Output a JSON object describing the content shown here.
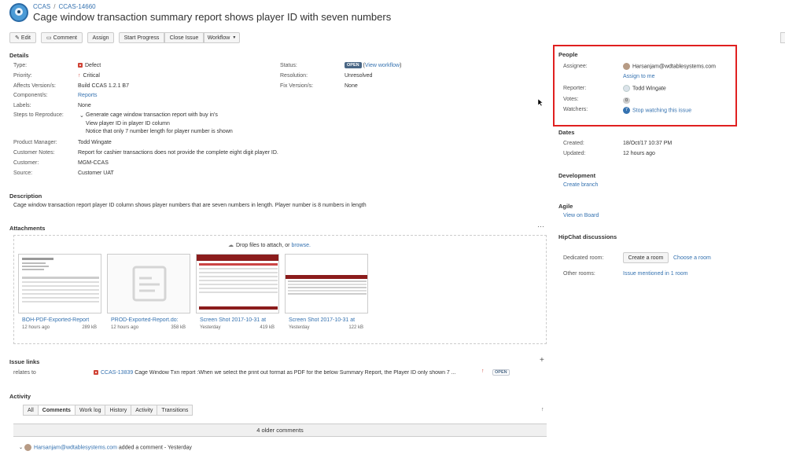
{
  "header": {
    "project": "CCAS",
    "issue_key": "CCAS-14660",
    "title": "Cage window transaction summary report shows player ID with seven numbers"
  },
  "toolbar": {
    "edit": "Edit",
    "comment": "Comment",
    "assign": "Assign",
    "start_progress": "Start Progress",
    "close_issue": "Close Issue",
    "workflow": "Workflow"
  },
  "details": {
    "title": "Details",
    "type_label": "Type:",
    "type": "Defect",
    "priority_label": "Priority:",
    "priority": "Critical",
    "affects_label": "Affects Version/s:",
    "affects": "Build CCAS 1.2.1 B7",
    "components_label": "Component/s:",
    "components": "Reports",
    "labels_label": "Labels:",
    "labels": "None",
    "steps_label": "Steps to Reproduce:",
    "steps": [
      "Generate cage window transaction report with buy in's",
      "View player ID in player ID column",
      "Notice that only 7 number length for player number is shown"
    ],
    "pm_label": "Product Manager:",
    "pm": "Todd Wingate",
    "notes_label": "Customer Notes:",
    "notes": "Report for cashier transactions does not provide the complete eight digit player ID.",
    "customer_label": "Customer:",
    "customer": "MGM-CCAS",
    "source_label": "Source:",
    "source": "Customer UAT",
    "status_label": "Status:",
    "status": "OPEN",
    "view_workflow": "View workflow",
    "resolution_label": "Resolution:",
    "resolution": "Unresolved",
    "fix_label": "Fix Version/s:",
    "fix": "None"
  },
  "description": {
    "title": "Description",
    "text": "Cage window transaction report player ID column shows player numbers that are seven numbers in length. Player number is 8 numbers in length"
  },
  "attachments": {
    "title": "Attachments",
    "drop_text": "Drop files to attach, or",
    "browse": "browse.",
    "items": [
      {
        "name": "BOH-PDF-Exported-Report",
        "time": "12 hours ago",
        "size": "289 kB"
      },
      {
        "name": "PROD-Exported-Report.do:",
        "time": "12 hours ago",
        "size": "358 kB"
      },
      {
        "name": "Screen Shot 2017-10-31 at",
        "time": "Yesterday",
        "size": "419 kB"
      },
      {
        "name": "Screen Shot 2017-10-31 at",
        "time": "Yesterday",
        "size": "122 kB"
      }
    ]
  },
  "issue_links": {
    "title": "Issue links",
    "relation": "relates to",
    "key": "CCAS-13839",
    "summary": "Cage Window Txn report :When we select the print out format as PDF for the below Summary Report, the Player ID only shown 7 ...",
    "status": "OPEN"
  },
  "activity": {
    "title": "Activity",
    "tabs": [
      "All",
      "Comments",
      "Work log",
      "History",
      "Activity",
      "Transitions"
    ],
    "active_tab": "Comments",
    "older": "4 older comments",
    "comment_author": "Harsanjam@wdtablesystems.com",
    "comment_meta": "added a comment - Yesterday"
  },
  "people": {
    "title": "People",
    "assignee_label": "Assignee:",
    "assignee": "Harsanjam@wdtablesystems.com",
    "assign_me": "Assign to me",
    "reporter_label": "Reporter:",
    "reporter": "Todd Wingate",
    "votes_label": "Votes:",
    "votes": "0",
    "watchers_label": "Watchers:",
    "watchers": "7",
    "stop_watching": "Stop watching this issue"
  },
  "dates": {
    "title": "Dates",
    "created_label": "Created:",
    "created": "18/Oct/17 10:37 PM",
    "updated_label": "Updated:",
    "updated": "12 hours ago"
  },
  "development": {
    "title": "Development",
    "create_branch": "Create branch"
  },
  "agile": {
    "title": "Agile",
    "view_board": "View on Board"
  },
  "hipchat": {
    "title": "HipChat discussions",
    "dedicated_label": "Dedicated room:",
    "create_room": "Create a room",
    "choose_room": "Choose a room",
    "other_label": "Other rooms:",
    "mentioned": "Issue mentioned in 1 room"
  },
  "colors": {
    "link": "#3572b0",
    "highlight": "#e02020",
    "defect": "#d04437",
    "lozenge": "#4a6785"
  }
}
